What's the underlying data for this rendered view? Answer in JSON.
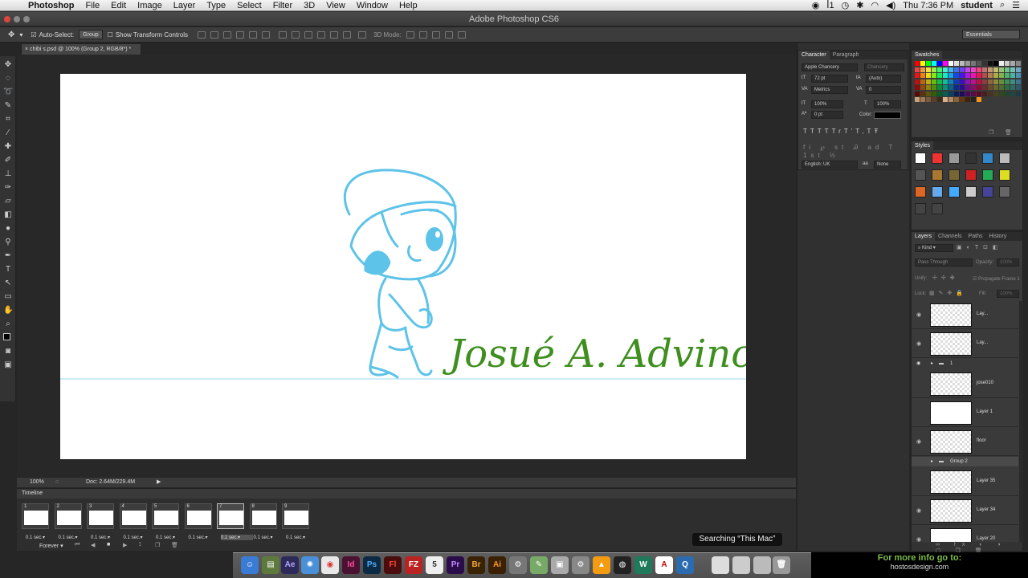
{
  "menubar": {
    "app": "Photoshop",
    "items": [
      "File",
      "Edit",
      "Image",
      "Layer",
      "Type",
      "Select",
      "Filter",
      "3D",
      "View",
      "Window",
      "Help"
    ],
    "clock": "Thu 7:36 PM",
    "user": "student"
  },
  "window": {
    "title": "Adobe Photoshop CS6"
  },
  "options": {
    "auto_select": "Auto-Select:",
    "auto_select_value": "Group",
    "transform": "Show Transform Controls",
    "mode3d": "3D Mode:",
    "workspace": "Essentials"
  },
  "document": {
    "tab": "chibi s.psd @ 100% (Group 2, RGB/8*) *",
    "zoom": "100%",
    "doc_info": "Doc: 2.64M/229.4M",
    "signature": "Josué A. Advincola"
  },
  "timeline": {
    "title": "Timeline",
    "frames": [
      {
        "num": "1",
        "delay": "0.1 sec."
      },
      {
        "num": "2",
        "delay": "0.1 sec."
      },
      {
        "num": "3",
        "delay": "0.1 sec."
      },
      {
        "num": "4",
        "delay": "0.1 sec."
      },
      {
        "num": "5",
        "delay": "0.1 sec."
      },
      {
        "num": "6",
        "delay": "0.1 sec."
      },
      {
        "num": "7",
        "delay": "0.1 sec."
      },
      {
        "num": "8",
        "delay": "0.1 sec."
      },
      {
        "num": "9",
        "delay": "0.1 sec."
      }
    ],
    "selected_frame": 7,
    "loop": "Forever"
  },
  "character": {
    "tabs": [
      "Character",
      "Paragraph"
    ],
    "font": "Apple Chancery",
    "style": "Chancery",
    "size": "72 pt",
    "leading": "(Auto)",
    "kerning": "Metrics",
    "tracking": "0",
    "vscale": "100%",
    "hscale": "100%",
    "baseline": "0 pt",
    "color_label": "Color:",
    "language": "English: UK",
    "antialias_label": "aa",
    "antialias": "None",
    "text_style_glyphs": [
      "T",
      "T",
      "TT",
      "Tr",
      "T'",
      "T,",
      "T",
      "Ŧ"
    ]
  },
  "swatches": {
    "title": "Swatches"
  },
  "styles": {
    "title": "Styles"
  },
  "layers": {
    "tabs": [
      "Layers",
      "Channels",
      "Paths",
      "History"
    ],
    "kind": "Kind",
    "blend": "Pass Through",
    "opacity_label": "Opacity:",
    "opacity": "100%",
    "unify": "Unify:",
    "propagate": "Propagate Frame 1",
    "lock": "Lock:",
    "fill_label": "Fill:",
    "fill": "100%",
    "rows": [
      {
        "name": "Lay...",
        "visible": true,
        "kind": "layer"
      },
      {
        "name": "Lay...",
        "visible": true,
        "kind": "layer"
      },
      {
        "name": "1",
        "visible": true,
        "kind": "group"
      },
      {
        "name": "jose010",
        "visible": false,
        "kind": "layer"
      },
      {
        "name": "Layer 1",
        "visible": false,
        "kind": "layer"
      },
      {
        "name": "floor",
        "visible": true,
        "kind": "layer"
      },
      {
        "name": "Group 2",
        "visible": false,
        "kind": "group"
      },
      {
        "name": "Layer 35",
        "visible": false,
        "kind": "layer"
      },
      {
        "name": "Layer 34",
        "visible": true,
        "kind": "layer"
      },
      {
        "name": "Layer 20",
        "visible": true,
        "kind": "layer"
      }
    ]
  },
  "spotlight": "Searching “This Mac”",
  "promo": {
    "line1": "For more info go to:",
    "line2": "hostosdesign.com"
  },
  "dock": [
    "Finder",
    "Ae",
    "Id",
    "Ps",
    "Fl",
    "FZ",
    "Pr",
    "Br",
    "Ai",
    "W"
  ],
  "colors": {
    "sketch_blue": "#5ec3e8",
    "signature_green": "#3f8f1f",
    "panel_bg": "#3a3a3a"
  }
}
